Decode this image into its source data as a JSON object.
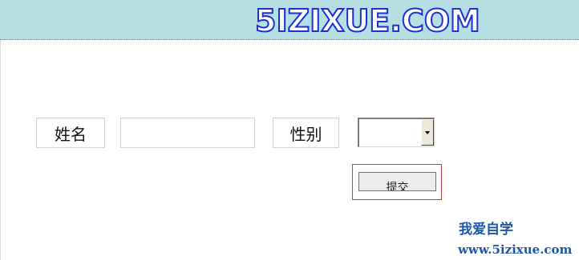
{
  "header": {
    "logo_text": "5IZIXUE.COM",
    "background": "#b6dfe4",
    "logo_outline_color": "#1f2fd6"
  },
  "form": {
    "name_label": "姓名",
    "name_value": "",
    "gender_label": "性别",
    "gender_selected": "",
    "submit_label": "提交",
    "submit_frame_color": "#b5473f"
  },
  "footer": {
    "brand_cn": "我爱自学",
    "brand_url": "www.5izixue.com",
    "brand_color": "#1f57a8"
  },
  "icons": {
    "select_arrow": "chevron-down-icon"
  }
}
